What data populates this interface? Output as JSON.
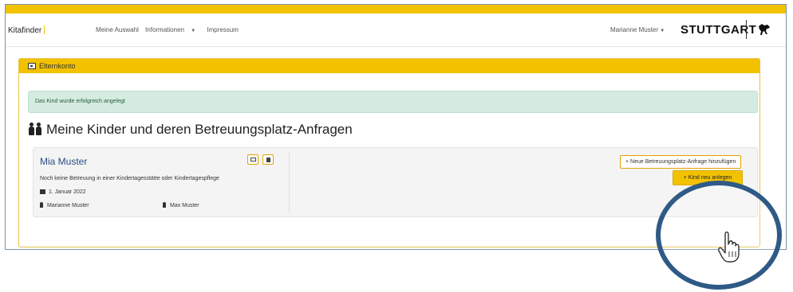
{
  "nav": {
    "brand": "Kitafinder",
    "links": [
      "Meine Auswahl",
      "Informationen",
      "Impressum"
    ],
    "user": "Marianne Muster",
    "logo": "STUTTGART"
  },
  "panel": {
    "title": "Elternkonto",
    "alert": "Das Kind wurde erfolgreich angelegt",
    "heading": "Meine Kinder und deren Betreuungsplatz-Anfragen"
  },
  "child": {
    "name": "Mia Muster",
    "status": "Noch keine Betreuung in einer Kindertagesstätte oder Kindertagespflege",
    "birthdate": "1. Januar 2022",
    "parent1": "Marianne Muster",
    "parent2": "Max Muster",
    "new_request_label": "+ Neue Betreuungsplatz-Anfrage hinzufügen"
  },
  "actions": {
    "add_child_label": "+ Kind neu anlegen"
  },
  "colors": {
    "accent": "#f2c200",
    "alert_bg": "#d4ece0",
    "link": "#2a4d85",
    "ring": "#2f5a86"
  },
  "icons": [
    "envelope-icon",
    "trash-icon",
    "birthday-cake-icon",
    "person-icon",
    "people-icon",
    "id-card-icon",
    "hand-cursor-icon",
    "stuttgart-horse-icon"
  ]
}
